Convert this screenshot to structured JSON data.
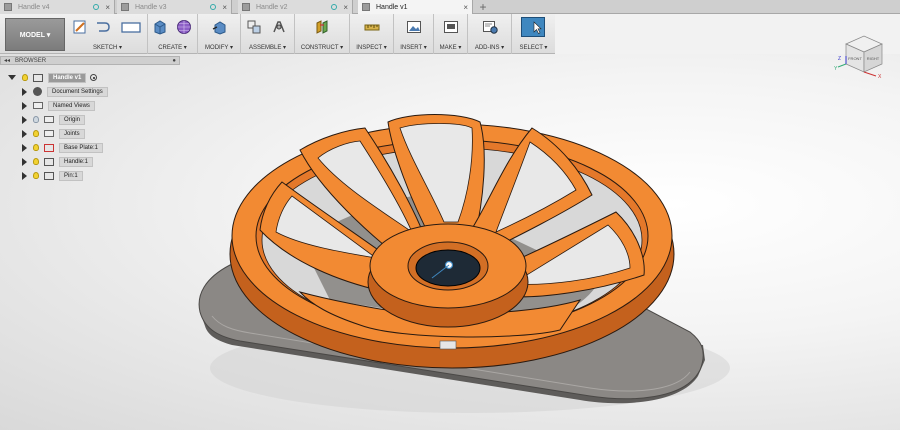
{
  "tabs": [
    {
      "label": "Handle v4",
      "active": false
    },
    {
      "label": "Handle v3",
      "active": false
    },
    {
      "label": "Handle v2",
      "active": false
    },
    {
      "label": "Handle v1",
      "active": true
    }
  ],
  "tab_add": "+",
  "tab_close": "×",
  "toolbar": {
    "workspace": "MODEL ▾",
    "groups": [
      {
        "label": "SKETCH ▾"
      },
      {
        "label": "CREATE ▾"
      },
      {
        "label": "MODIFY ▾"
      },
      {
        "label": "ASSEMBLE ▾"
      },
      {
        "label": "CONSTRUCT ▾"
      },
      {
        "label": "INSPECT ▾"
      },
      {
        "label": "INSERT ▾"
      },
      {
        "label": "MAKE ▾"
      },
      {
        "label": "ADD-INS ▾"
      },
      {
        "label": "SELECT ▾"
      }
    ]
  },
  "browser": {
    "collapse": "◂◂",
    "title": "BROWSER",
    "pin": "●",
    "root": "Handle v1",
    "items": [
      {
        "label": "Document Settings"
      },
      {
        "label": "Named Views"
      },
      {
        "label": "Origin"
      },
      {
        "label": "Joints"
      },
      {
        "label": "Base Plate:1"
      },
      {
        "label": "Handle:1"
      },
      {
        "label": "Pin:1"
      }
    ]
  },
  "viewcube": {
    "front": "FRONT",
    "right": "RIGHT",
    "axis_x": "X",
    "axis_y": "Y",
    "axis_z": "Z"
  },
  "colors": {
    "handle": "#f28a33",
    "handle_dark": "#c4611d",
    "plate": "#7d7b79",
    "plate_top": "#9a9794",
    "accent": "#3f87bf"
  }
}
